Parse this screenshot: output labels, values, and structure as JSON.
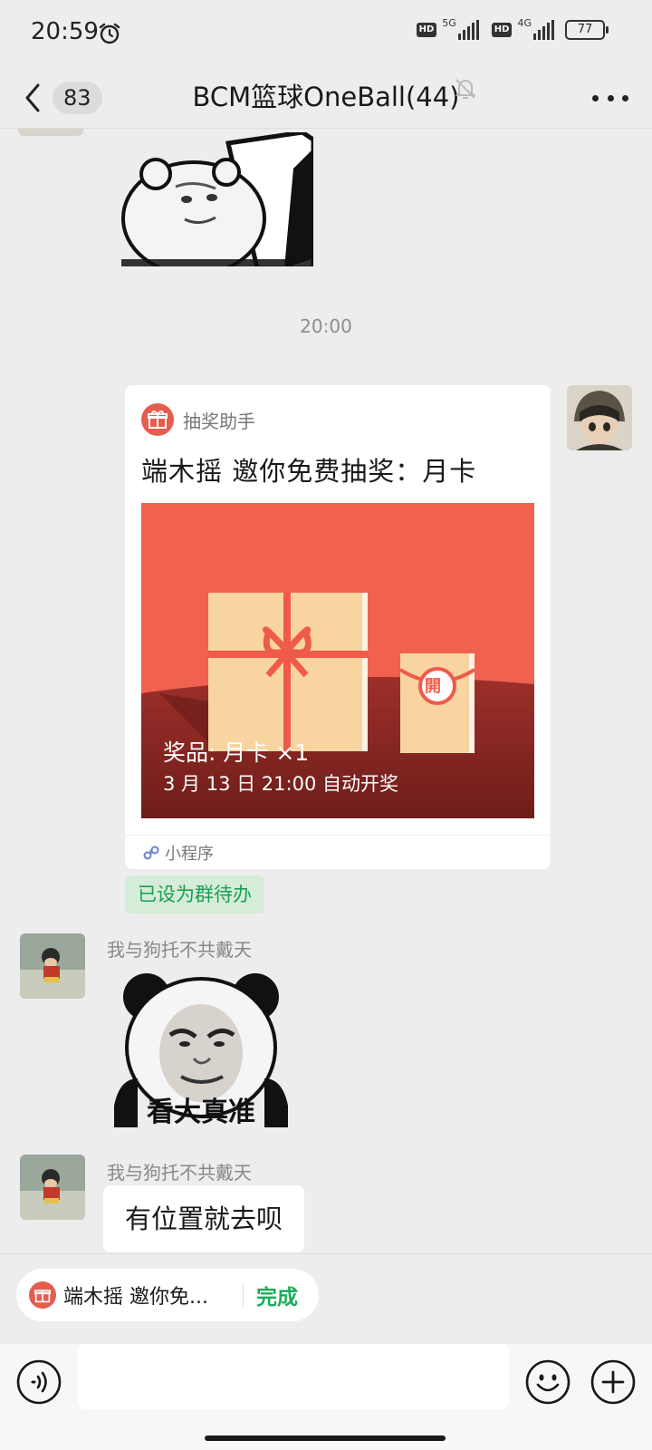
{
  "status_bar": {
    "time": "20:59",
    "hd1": "HD",
    "network1": "5G",
    "hd2": "HD",
    "network2": "4G",
    "battery": "77"
  },
  "nav": {
    "unread_count": "83",
    "title": "BCM篮球OneBall(44)"
  },
  "chat": {
    "time_divider": "20:00",
    "card": {
      "source": "抽奖助手",
      "title": "端木摇 邀你免费抽奖：月卡",
      "prize": "奖品: 月卡  ×1",
      "draw_time": "3 月 13 日 21:00 自动开奖",
      "open_char": "開",
      "footer": "小程序"
    },
    "todo_tag": "已设为群待办",
    "messages": [
      {
        "sender": "我与狗托不共戴天",
        "sticker_caption": "看大真准"
      },
      {
        "sender": "我与狗托不共戴天",
        "text": "有位置就去呗"
      }
    ]
  },
  "todo_bar": {
    "text": "端木摇 邀你免...",
    "done": "完成"
  },
  "input": {
    "placeholder": ""
  },
  "colors": {
    "accent_green": "#1aad5a",
    "card_red": "#f06150",
    "background": "#ededed"
  }
}
